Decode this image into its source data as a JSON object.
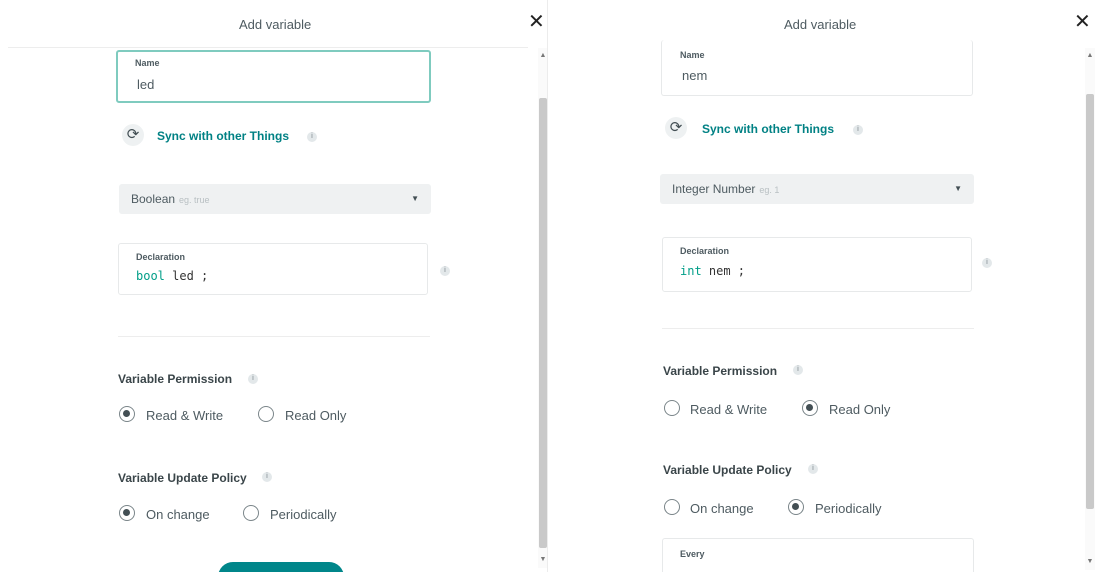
{
  "left": {
    "title": "Add variable",
    "name_label": "Name",
    "name_value": "led",
    "sync_label": "Sync with other Things",
    "type_value": "Boolean",
    "type_placeholder": "eg. true",
    "declaration_label": "Declaration",
    "decl_keyword": "bool",
    "decl_rest": " led ;",
    "permission_title": "Variable Permission",
    "permission_options": [
      "Read & Write",
      "Read Only"
    ],
    "permission_selected": "Read & Write",
    "policy_title": "Variable Update Policy",
    "policy_options": [
      "On change",
      "Periodically"
    ],
    "policy_selected": "On change"
  },
  "right": {
    "title": "Add variable",
    "name_label": "Name",
    "name_value": "nem",
    "sync_label": "Sync with other Things",
    "type_value": "Integer Number",
    "type_placeholder": "eg. 1",
    "declaration_label": "Declaration",
    "decl_keyword": "int",
    "decl_rest": " nem ;",
    "permission_title": "Variable Permission",
    "permission_options": [
      "Read & Write",
      "Read Only"
    ],
    "permission_selected": "Read Only",
    "policy_title": "Variable Update Policy",
    "policy_options": [
      "On change",
      "Periodically"
    ],
    "policy_selected": "Periodically",
    "every_label": "Every"
  },
  "icons": {
    "close": "close-icon",
    "sync": "sync-icon",
    "info": "info-icon",
    "caret": "chevron-down-icon"
  },
  "colors": {
    "accent": "#008184",
    "focus_border": "#7fcbbf",
    "button": "#00868a"
  }
}
